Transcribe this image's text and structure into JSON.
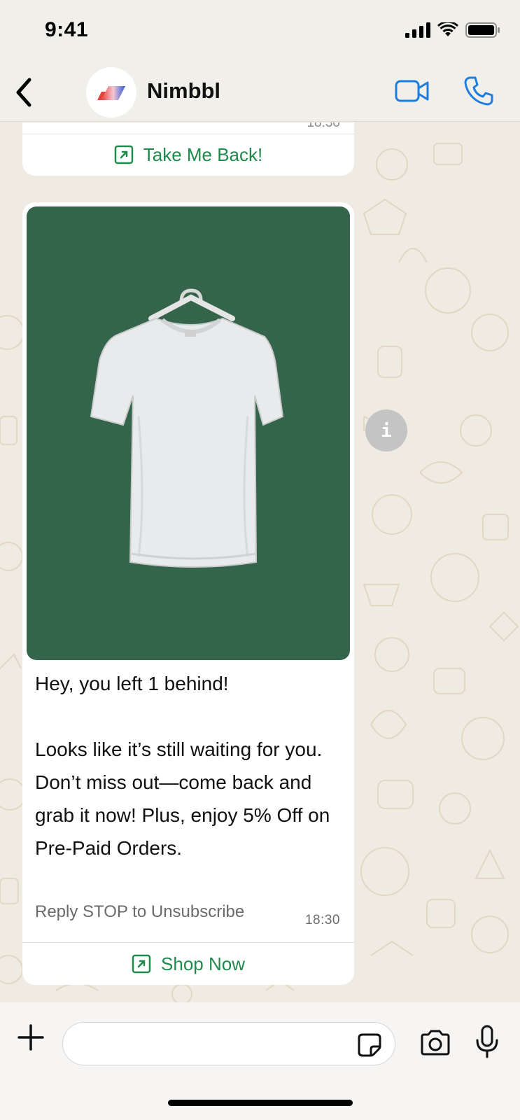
{
  "status_bar": {
    "time": "9:41"
  },
  "header": {
    "contact_name": "Nimbbl"
  },
  "chat": {
    "previous_message": {
      "time": "18:30",
      "button_label": "Take Me Back!"
    },
    "message": {
      "heading": "Hey, you left 1 behind!",
      "body": "Looks like it’s still waiting for you. Don’t miss out—come back and grab it now! Plus, enjoy 5% Off on Pre-Paid Orders.",
      "footer": "Reply STOP to Unsubscribe",
      "time": "18:30",
      "button_label": "Shop Now"
    },
    "info_icon_glyph": "i"
  },
  "composer": {
    "placeholder": ""
  },
  "colors": {
    "accent": "#1f8a4c",
    "link_blue": "#1c7ce0",
    "media_background": "#34654a",
    "chat_background": "#efeae2"
  },
  "icons": {
    "back": "chevron-left-icon",
    "video": "video-call-icon",
    "phone": "phone-call-icon",
    "cta": "external-link-icon",
    "info": "info-icon",
    "plus": "plus-icon",
    "sticker": "sticker-icon",
    "camera": "camera-icon",
    "mic": "microphone-icon"
  }
}
